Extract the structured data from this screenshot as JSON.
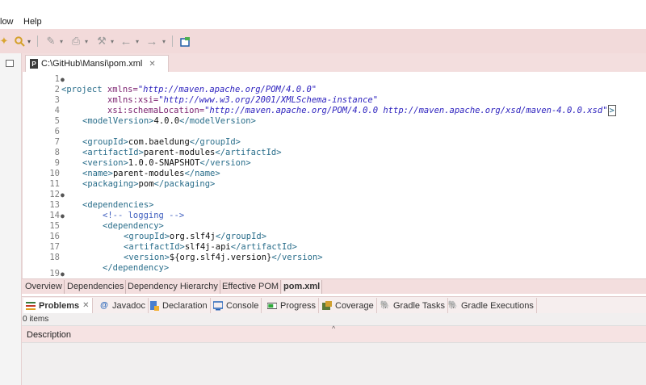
{
  "menubar": {
    "items": [
      "low",
      "Help"
    ]
  },
  "toolbar": {
    "icons": [
      "new-icon",
      "search-icon",
      "dropdown-icon",
      "edit-icon",
      "print-icon",
      "tools-icon",
      "back-icon",
      "forward-icon",
      "window-icon"
    ]
  },
  "editor": {
    "tab_label": "C:\\GitHub\\Mansi\\pom.xml",
    "tab_close": "✕",
    "lines": [
      {
        "n": "1",
        "fold": "●"
      },
      {
        "n": "2",
        "fold": ""
      },
      {
        "n": "3",
        "fold": ""
      },
      {
        "n": "4",
        "fold": ""
      },
      {
        "n": "5",
        "fold": ""
      },
      {
        "n": "6",
        "fold": ""
      },
      {
        "n": "7",
        "fold": ""
      },
      {
        "n": "8",
        "fold": ""
      },
      {
        "n": "9",
        "fold": ""
      },
      {
        "n": "10",
        "fold": ""
      },
      {
        "n": "11",
        "fold": ""
      },
      {
        "n": "12",
        "fold": "●"
      },
      {
        "n": "13",
        "fold": ""
      },
      {
        "n": "14",
        "fold": "●"
      },
      {
        "n": "15",
        "fold": ""
      },
      {
        "n": "16",
        "fold": ""
      },
      {
        "n": "17",
        "fold": ""
      },
      {
        "n": "18",
        "fold": ""
      },
      {
        "n": "19",
        "fold": "●"
      }
    ],
    "code": {
      "l1_open": "<project",
      "l1_attr": " xmlns=",
      "l1_val": "\"http://maven.apache.org/POM/4.0.0\"",
      "l2_attr": "xmlns:xsi=",
      "l2_val": "\"http://www.w3.org/2001/XMLSchema-instance\"",
      "l3_attr": "xsi:schemaLocation=",
      "l3_val": "\"http://maven.apache.org/POM/4.0.0 http://maven.apache.org/xsd/maven-4.0.0.xsd\"",
      "l3_end": ">",
      "l4_open": "<modelVersion>",
      "l4_txt": "4.0.0",
      "l4_close": "</modelVersion>",
      "l6_open": "<groupId>",
      "l6_txt": "com.baeldung",
      "l6_close": "</groupId>",
      "l7_open": "<artifactId>",
      "l7_txt": "parent-modules",
      "l7_close": "</artifactId>",
      "l8_open": "<version>",
      "l8_txt": "1.0.0-SNAPSHOT",
      "l8_close": "</version>",
      "l9_open": "<name>",
      "l9_txt": "parent-modules",
      "l9_close": "</name>",
      "l10_open": "<packaging>",
      "l10_txt": "pom",
      "l10_close": "</packaging>",
      "l12_open": "<dependencies>",
      "l13_cmt": "<!-- logging -->",
      "l14_open": "<dependency>",
      "l15_open": "<groupId>",
      "l15_txt": "org.slf4j",
      "l15_close": "</groupId>",
      "l16_open": "<artifactId>",
      "l16_txt": "slf4j-api",
      "l16_close": "</artifactId>",
      "l17_open": "<version>",
      "l17_txt": "${org.slf4j.version}",
      "l17_close": "</version>",
      "l18_close": "</dependency>"
    }
  },
  "pom_tabs": [
    "Overview",
    "Dependencies",
    "Dependency Hierarchy",
    "Effective POM",
    "pom.xml"
  ],
  "view_tabs": [
    "Problems",
    "Javadoc",
    "Declaration",
    "Console",
    "Progress",
    "Coverage",
    "Gradle Tasks",
    "Gradle Executions"
  ],
  "problems": {
    "count": "0 items",
    "column": "Description"
  }
}
